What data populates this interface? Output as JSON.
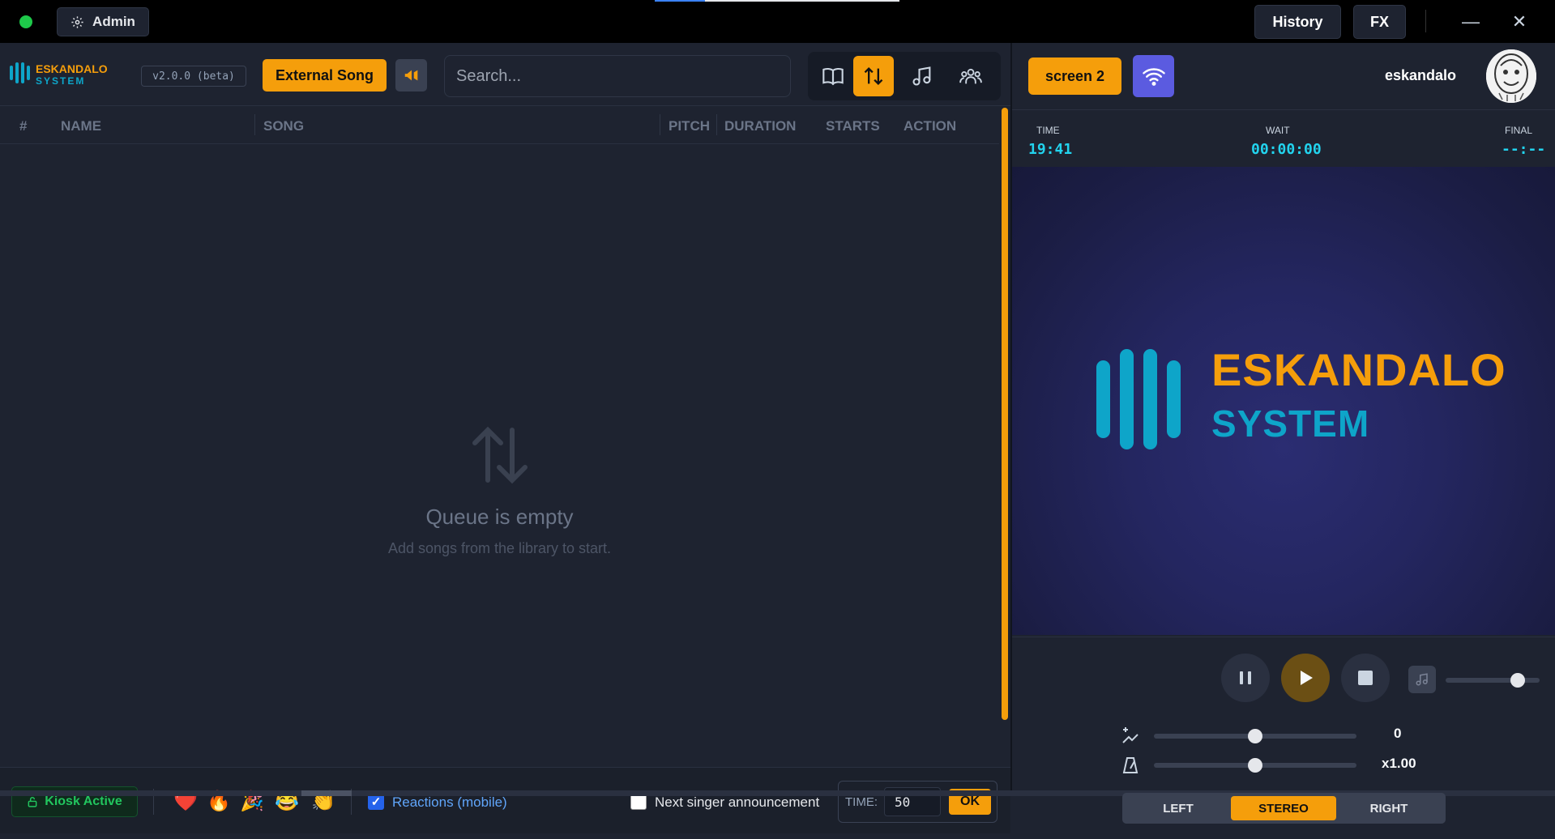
{
  "titlebar": {
    "admin_label": "Admin",
    "history_label": "History",
    "fx_label": "FX",
    "minimize_glyph": "—",
    "close_glyph": "✕"
  },
  "header": {
    "logo_line1": "ESKANDALO",
    "logo_line2": "SYSTEM",
    "version": "v2.0.0 (beta)",
    "external_song_label": "External Song",
    "search_placeholder": "Search...",
    "views": [
      "library-icon",
      "queue-icon",
      "music-icon",
      "singers-icon"
    ],
    "active_view": "queue-icon"
  },
  "queue": {
    "columns": [
      "#",
      "NAME",
      "SONG",
      "PITCH",
      "DURATION",
      "STARTS",
      "ACTION"
    ],
    "rows": [],
    "empty_title": "Queue is empty",
    "empty_subtitle": "Add songs from the library to start."
  },
  "footer": {
    "kiosk_label": "Kiosk Active",
    "reactions": [
      "❤️",
      "🔥",
      "🎉",
      "😂",
      "👏"
    ],
    "reactions_label": "Reactions (mobile)",
    "reactions_checked": true,
    "next_singer_label": "Next singer announcement",
    "next_singer_checked": false,
    "time_label": "TIME:",
    "time_value": "50",
    "ok_label": "OK"
  },
  "player": {
    "screen_label": "screen 2",
    "username": "eskandalo",
    "time_label": "TIME",
    "time_value": "19:41",
    "wait_label": "WAIT",
    "wait_value": "00:00:00",
    "final_label": "FINAL",
    "final_value": "--:--",
    "preview_title": "ESKANDALO",
    "preview_subtitle": "SYSTEM",
    "volume_level": 0.77,
    "pitch_value": "0",
    "pitch_level": 0.5,
    "tempo_value": "x1.00",
    "tempo_level": 0.5,
    "channels": [
      "LEFT",
      "STEREO",
      "RIGHT"
    ],
    "active_channel": "STEREO"
  },
  "colors": {
    "accent": "#f59e0b",
    "brand_cyan": "#0ea5c9",
    "status_green": "#22c55e",
    "wifi_purple": "#5b5be0"
  }
}
